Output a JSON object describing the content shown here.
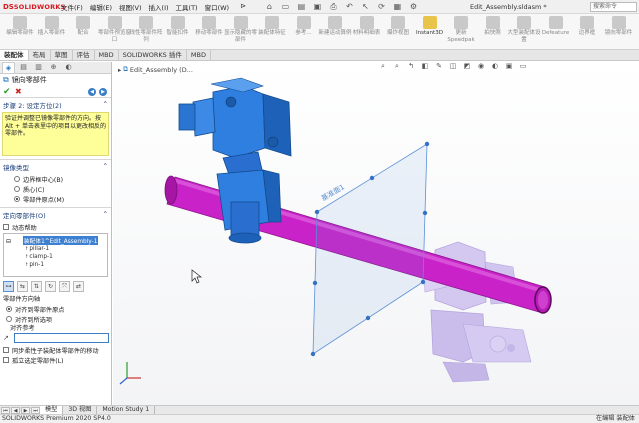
{
  "app": {
    "logo_prefix": "DS",
    "logo_name": "SOLIDWORKS",
    "document_title": "Edit_Assembly.sldasm *",
    "search_placeholder": "搜索命令"
  },
  "menus": [
    "文件(F)",
    "编辑(E)",
    "视图(V)",
    "插入(I)",
    "工具(T)",
    "窗口(W)"
  ],
  "command_manager": [
    {
      "label": "编辑零部件",
      "icon": "edit-component-icon",
      "active": false
    },
    {
      "label": "插入零部件",
      "icon": "insert-component-icon",
      "active": false
    },
    {
      "label": "配合",
      "icon": "mate-icon",
      "active": false
    },
    {
      "label": "零部件预览窗口",
      "icon": "preview-window-icon",
      "active": false
    },
    {
      "label": "线性零部件阵列",
      "icon": "linear-pattern-icon",
      "active": false
    },
    {
      "label": "智能扣件",
      "icon": "smart-fastener-icon",
      "active": false
    },
    {
      "label": "移动零部件",
      "icon": "move-component-icon",
      "active": false
    },
    {
      "label": "显示隐藏的零部件",
      "icon": "show-hidden-icon",
      "active": false
    },
    {
      "label": "装配体特征",
      "icon": "assembly-feature-icon",
      "active": false
    },
    {
      "label": "参考...",
      "icon": "reference-geometry-icon",
      "active": false
    },
    {
      "label": "新建运动算例",
      "icon": "motion-study-icon",
      "active": false
    },
    {
      "label": "材料明细表",
      "icon": "bom-icon",
      "active": false
    },
    {
      "label": "爆炸视图",
      "icon": "exploded-view-icon",
      "active": false
    },
    {
      "label": "Instant3D",
      "icon": "instant3d-icon",
      "active": true
    },
    {
      "label": "更新Speedpak",
      "icon": "speedpak-icon",
      "active": false
    },
    {
      "label": "拍快照",
      "icon": "snapshot-icon",
      "active": false
    },
    {
      "label": "大型装配体设置",
      "icon": "large-assembly-icon",
      "active": false
    },
    {
      "label": "Defeature",
      "icon": "defeature-icon",
      "active": false
    },
    {
      "label": "边界框",
      "icon": "bounding-box-icon",
      "active": false
    },
    {
      "label": "镜向零部件",
      "icon": "mirror-component-icon",
      "active": false
    }
  ],
  "tabs": [
    "装配体",
    "布局",
    "草图",
    "评估",
    "MBD",
    "SOLIDWORKS 插件",
    "MBD"
  ],
  "selected_tab": 0,
  "panel": {
    "title": "镜向零部件",
    "step_title": "步骤 2: 设定方位(2)",
    "step_text": "验证并调整已镜像零部件的方向。按 Alt + 单击表里中的项目以更改相反的零部件。",
    "mirror_type_title": "镜像类型",
    "mirror_types": [
      "边界框中心(B)",
      "质心(C)",
      "零部件原点(M)"
    ],
    "mirror_type_selected": 2,
    "oriented_title": "定向零部件(O)",
    "dynamic_help": "动态帮助",
    "tree_root": "装配体1^Edit_Assembly-1",
    "tree_items": [
      "pillar-1",
      "clamp-1",
      "pin-1"
    ],
    "orientation_title": "零部件方向轴",
    "orientation_options": [
      "对齐到零部件原点",
      "对齐到所选项"
    ],
    "orientation_selected": 0,
    "align_ref_label": "对齐参考",
    "sync_label": "同步柔性子装配体零部件的移动",
    "isolate_label": "孤立选定零部件(L)"
  },
  "viewport": {
    "tree_label": "Edit_Assembly (D...",
    "plane_label": "基准面1"
  },
  "colors": {
    "blue_part": "#2f7fe0",
    "magenta_pipe": "#c822c8",
    "ghost": "#a78be0",
    "plane": "#6aa0e0"
  },
  "bottom_tabs": [
    "模型",
    "3D 视图",
    "Motion Study 1"
  ],
  "bottom_tab_selected": 0,
  "status": {
    "left": "SOLIDWORKS Premium 2020 SP4.0",
    "right": "在编辑 装配体"
  }
}
